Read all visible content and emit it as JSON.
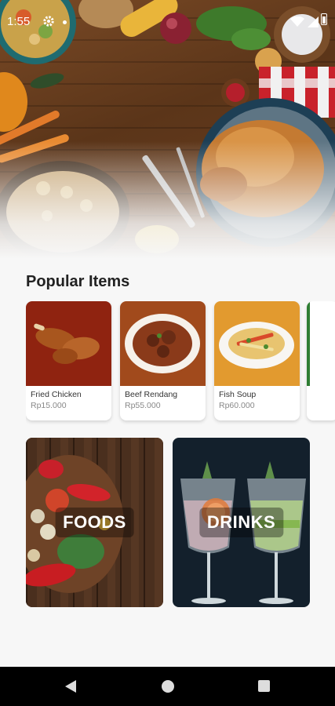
{
  "status_bar": {
    "time": "1:55",
    "icons": [
      "gear-icon",
      "notification-dot-icon",
      "wifi-icon",
      "signal-icon",
      "battery-icon"
    ]
  },
  "hero": {
    "description_icon": "food-table-banner"
  },
  "popular": {
    "title": "Popular Items",
    "items": [
      {
        "name": "Fried Chicken",
        "price": "Rp15.000",
        "bg": "#8f2310"
      },
      {
        "name": "Beef Rendang",
        "price": "Rp55.000",
        "bg": "#a14a1c"
      },
      {
        "name": "Fish Soup",
        "price": "Rp60.000",
        "bg": "#e29a2f"
      }
    ]
  },
  "categories": [
    {
      "label": "FOODS"
    },
    {
      "label": "DRINKS"
    }
  ],
  "nav": {
    "icons": [
      "back-icon",
      "home-icon",
      "recents-icon"
    ]
  },
  "colors": {
    "background": "#f7f7f7",
    "title_text": "#222222",
    "price_text": "#888888",
    "nav_bar": "#000000"
  }
}
